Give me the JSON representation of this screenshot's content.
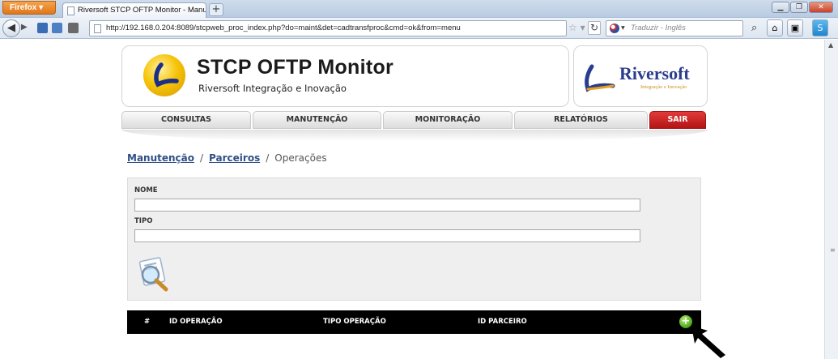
{
  "browser": {
    "menu_button": "Firefox ▾",
    "tab_title": "Riversoft STCP OFTP Monitor - Manuten...",
    "url": "http://192.168.0.204:8089/stcpweb_proc_index.php?do=maint&det=cadtransfproc&cmd=ok&from=menu",
    "translate_placeholder": "Traduzir - Inglês"
  },
  "header": {
    "title": "STCP OFTP Monitor",
    "subtitle": "Riversoft Integração e Inovação",
    "brand_name": "Riversoft",
    "brand_tagline": "Integração e Inovação"
  },
  "menu": {
    "items": [
      "CONSULTAS",
      "MANUTENÇÃO",
      "MONITORAÇÃO",
      "RELATÓRIOS"
    ],
    "exit": "SAIR"
  },
  "breadcrumb": {
    "level1": "Manutenção",
    "level2": "Parceiros",
    "current": "Operações",
    "separator": "/"
  },
  "form": {
    "nome_label": "NOME",
    "nome_value": "",
    "tipo_label": "TIPO",
    "tipo_value": ""
  },
  "table": {
    "columns": [
      "#",
      "ID OPERAÇÃO",
      "TIPO OPERAÇÃO",
      "ID PARCEIRO"
    ]
  },
  "colors": {
    "menu_exit": "#c21b1b",
    "breadcrumb_link": "#2f4f86",
    "table_header": "#000000",
    "add_button": "#4aa512"
  }
}
